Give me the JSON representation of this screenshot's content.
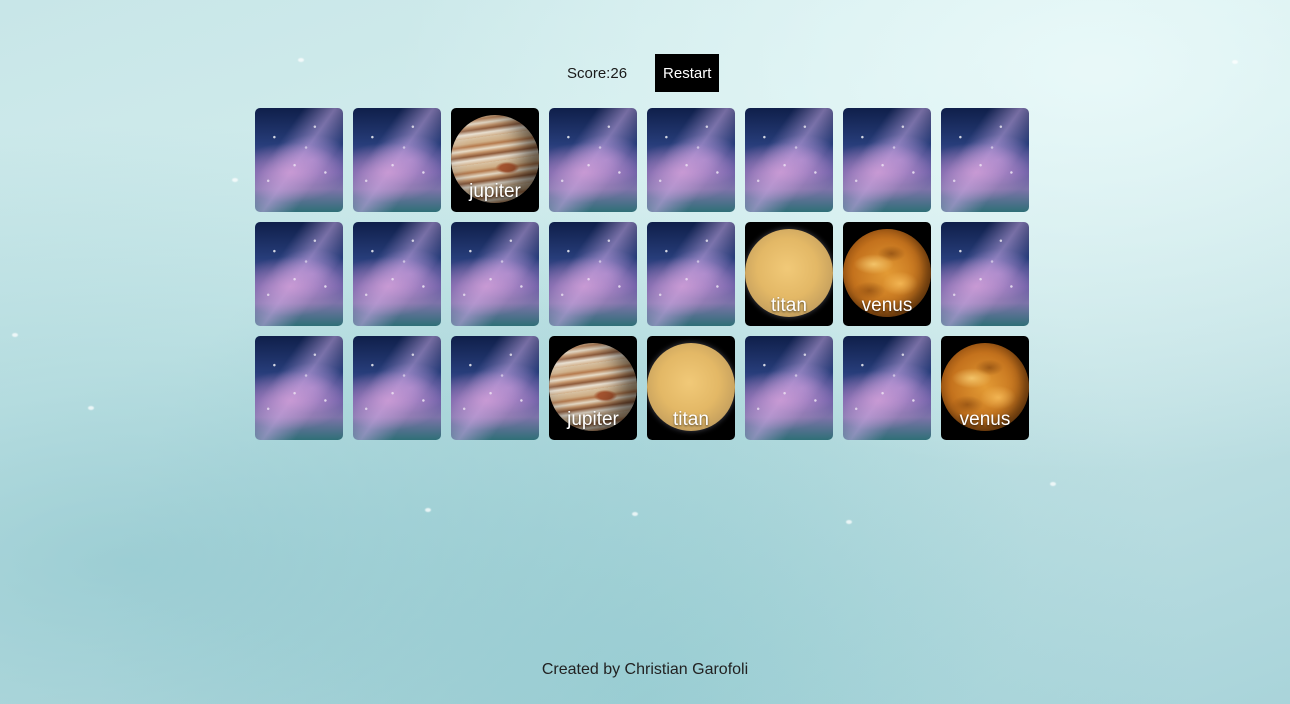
{
  "header": {
    "score_label": "Score:26",
    "restart_label": "Restart"
  },
  "board": {
    "columns": 8,
    "cards": [
      {
        "state": "hidden",
        "name": ""
      },
      {
        "state": "hidden",
        "name": ""
      },
      {
        "state": "revealed",
        "name": "jupiter"
      },
      {
        "state": "hidden",
        "name": ""
      },
      {
        "state": "hidden",
        "name": ""
      },
      {
        "state": "hidden",
        "name": ""
      },
      {
        "state": "hidden",
        "name": ""
      },
      {
        "state": "hidden",
        "name": ""
      },
      {
        "state": "hidden",
        "name": ""
      },
      {
        "state": "hidden",
        "name": ""
      },
      {
        "state": "hidden",
        "name": ""
      },
      {
        "state": "hidden",
        "name": ""
      },
      {
        "state": "hidden",
        "name": ""
      },
      {
        "state": "revealed",
        "name": "titan"
      },
      {
        "state": "revealed",
        "name": "venus"
      },
      {
        "state": "hidden",
        "name": ""
      },
      {
        "state": "hidden",
        "name": ""
      },
      {
        "state": "hidden",
        "name": ""
      },
      {
        "state": "hidden",
        "name": ""
      },
      {
        "state": "revealed",
        "name": "jupiter"
      },
      {
        "state": "revealed",
        "name": "titan"
      },
      {
        "state": "hidden",
        "name": ""
      },
      {
        "state": "hidden",
        "name": ""
      },
      {
        "state": "revealed",
        "name": "venus"
      }
    ]
  },
  "footer": {
    "credit": "Created by Christian Garofoli"
  }
}
